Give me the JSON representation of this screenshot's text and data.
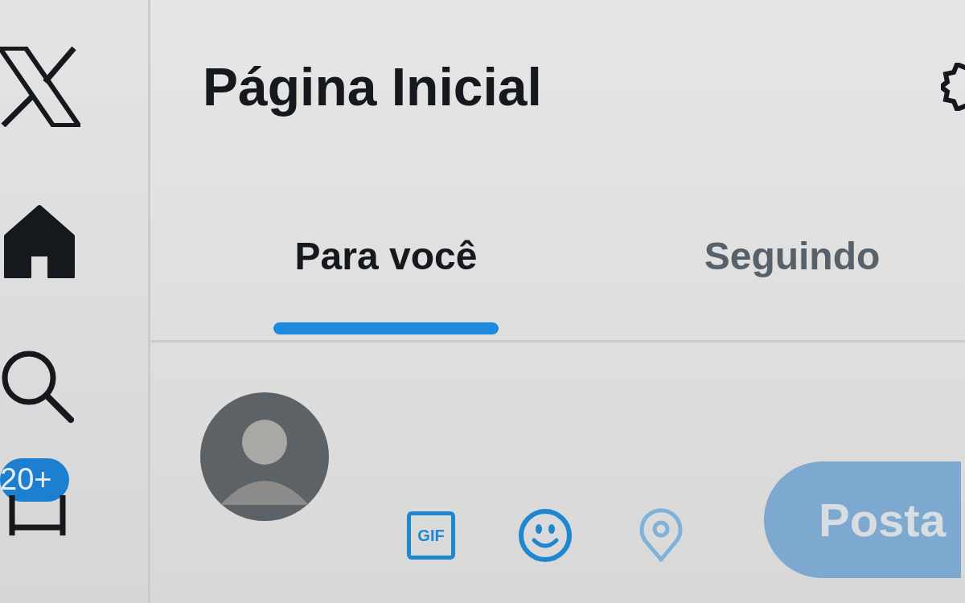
{
  "sidebar": {
    "items": [
      {
        "kind": "home",
        "selected": true
      },
      {
        "kind": "search",
        "selected": false
      }
    ],
    "badge": "20+"
  },
  "header": {
    "title": "Página Inicial"
  },
  "tabs": [
    {
      "label": "Para você",
      "selected": true
    },
    {
      "label": "Seguindo",
      "selected": false
    }
  ],
  "composer": {
    "tools": [
      {
        "kind": "gif",
        "label": "GIF",
        "disabled": false
      },
      {
        "kind": "emoji",
        "disabled": false
      },
      {
        "kind": "location",
        "disabled": true
      }
    ],
    "post_button": {
      "label": "Posta",
      "disabled": true
    }
  }
}
